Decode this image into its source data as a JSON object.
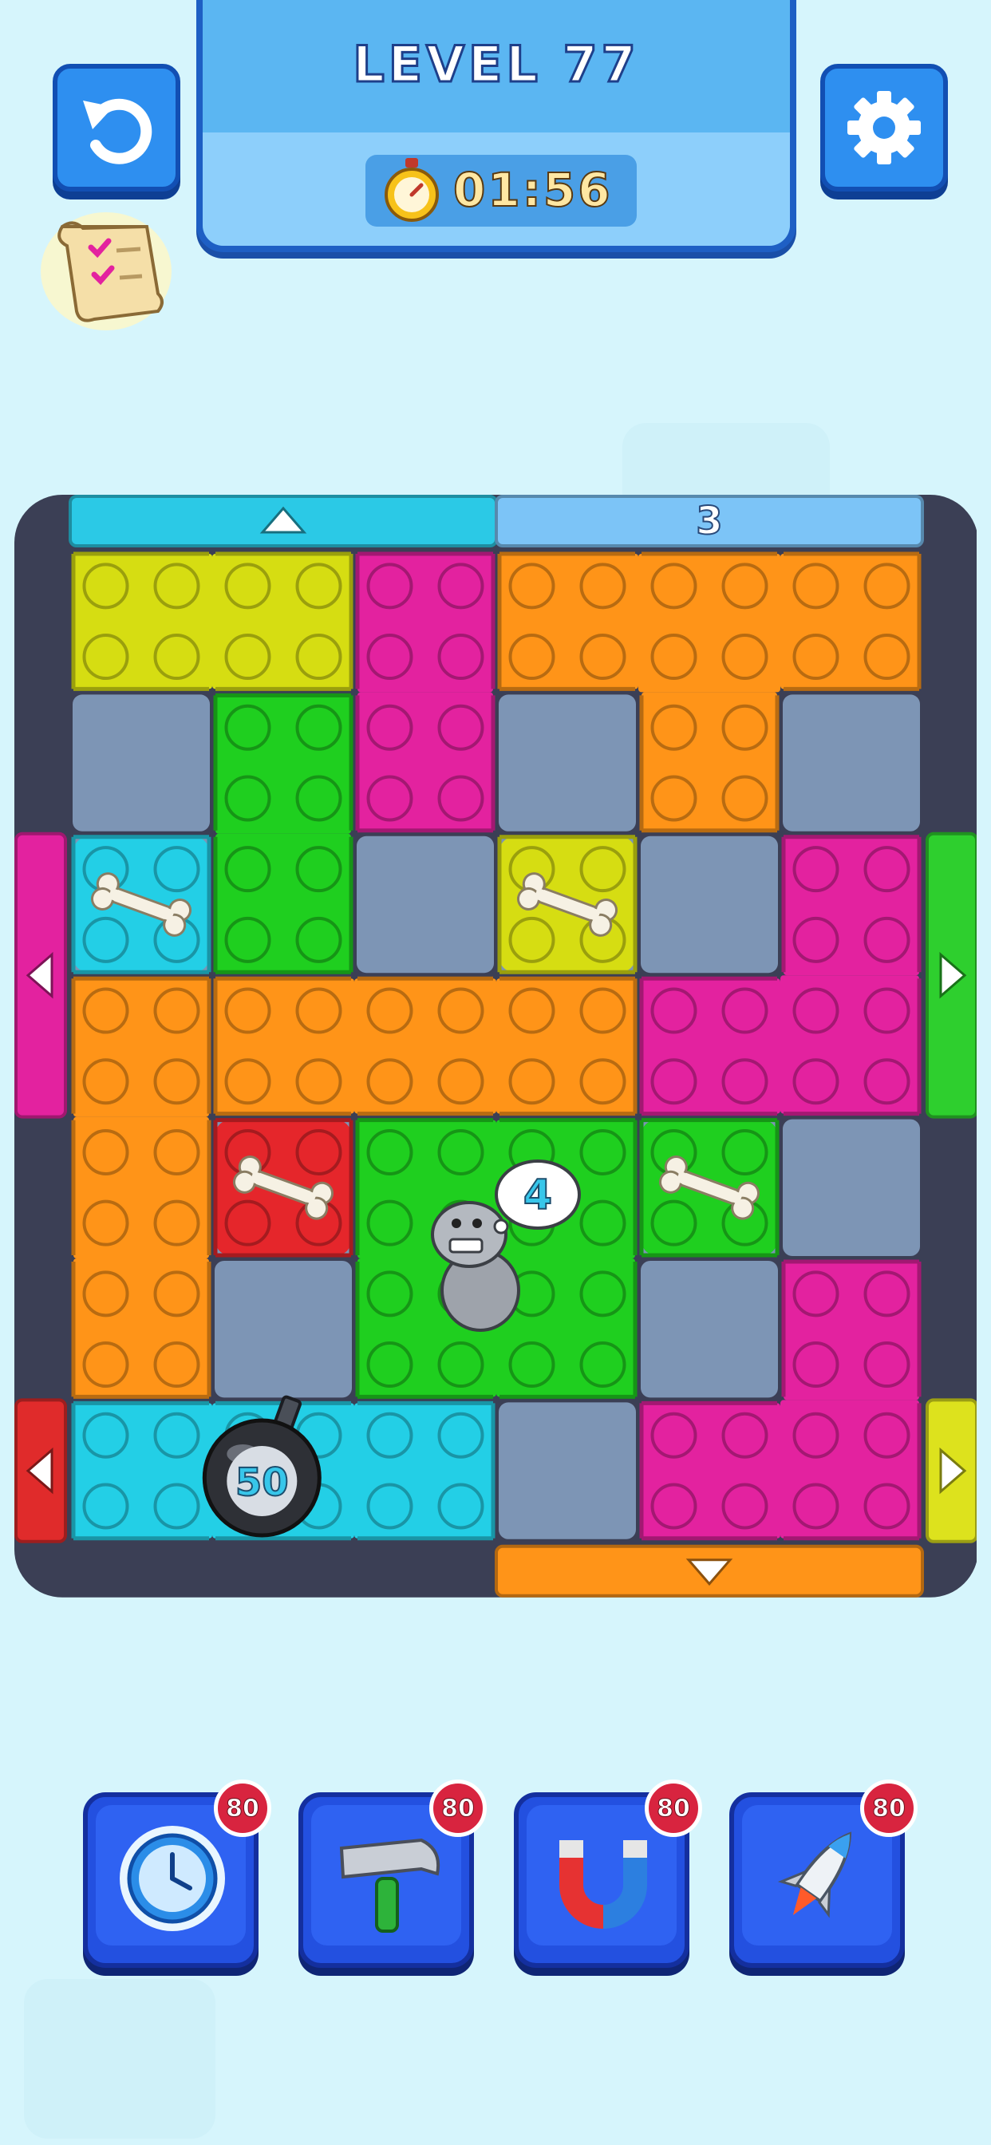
{
  "header": {
    "level_label": "LEVEL 77",
    "timer": "01:56"
  },
  "icons": {
    "undo": "undo-arrow-icon",
    "settings": "gear-icon",
    "quest": "scroll-checklist-icon",
    "timer": "stopwatch-icon"
  },
  "board": {
    "cols": 6,
    "rows": 7,
    "wall_color": "#3b3f55",
    "empty_cell_color": "#7d95b5",
    "exits": [
      {
        "side": "top",
        "color": "#2bc9e6",
        "arrow": "up",
        "span": [
          0,
          3
        ]
      },
      {
        "side": "top",
        "color": "#7cc4f7",
        "label": "3",
        "frozen": true,
        "span": [
          3,
          6
        ]
      },
      {
        "side": "left",
        "color": "#e3229f",
        "arrow": "left",
        "span": [
          2,
          4
        ]
      },
      {
        "side": "right",
        "color": "#2ecf2e",
        "arrow": "right",
        "span": [
          2,
          4
        ]
      },
      {
        "side": "left",
        "color": "#e02b2b",
        "arrow": "left",
        "span": [
          6,
          7
        ]
      },
      {
        "side": "right",
        "color": "#dde21d",
        "arrow": "right",
        "span": [
          6,
          7
        ]
      },
      {
        "side": "bottom",
        "color": "#ff9418",
        "arrow": "down",
        "span": [
          3,
          6
        ]
      }
    ],
    "blocks": [
      {
        "id": "yellow-top",
        "color": "#d6dd12",
        "cells": [
          [
            0,
            0
          ],
          [
            1,
            0
          ]
        ],
        "studs": [
          4,
          2
        ]
      },
      {
        "id": "magenta-top",
        "color": "#e3229f",
        "cells": [
          [
            2,
            0
          ],
          [
            2,
            1
          ]
        ],
        "studs": [
          2,
          4
        ]
      },
      {
        "id": "orange-t",
        "color": "#ff9418",
        "cells": [
          [
            3,
            0
          ],
          [
            4,
            0
          ],
          [
            5,
            0
          ],
          [
            4,
            1
          ]
        ],
        "studs": [
          6,
          2
        ],
        "shape": "T"
      },
      {
        "id": "green-vertical",
        "color": "#1fcf1f",
        "cells": [
          [
            1,
            1
          ],
          [
            1,
            2
          ]
        ],
        "studs": [
          2,
          4
        ]
      },
      {
        "id": "cyan-bone",
        "color": "#23cfe6",
        "cells": [
          [
            0,
            2
          ]
        ],
        "bone": true
      },
      {
        "id": "yellow-bone",
        "color": "#d6dd12",
        "cells": [
          [
            3,
            2
          ]
        ],
        "bone": true
      },
      {
        "id": "magenta-l",
        "color": "#e3229f",
        "cells": [
          [
            5,
            2
          ],
          [
            4,
            3
          ],
          [
            5,
            3
          ]
        ],
        "shape": "L"
      },
      {
        "id": "orange-vertical",
        "color": "#ff9418",
        "cells": [
          [
            0,
            3
          ],
          [
            0,
            4
          ],
          [
            0,
            5
          ]
        ],
        "studs": [
          2,
          6
        ]
      },
      {
        "id": "orange-horizontal",
        "color": "#ff9418",
        "cells": [
          [
            1,
            3
          ],
          [
            2,
            3
          ],
          [
            3,
            3
          ]
        ],
        "studs": [
          6,
          2
        ]
      },
      {
        "id": "red-bone",
        "color": "#e5262b",
        "cells": [
          [
            1,
            4
          ]
        ],
        "bone": true
      },
      {
        "id": "green-dog",
        "color": "#1fcf1f",
        "cells": [
          [
            2,
            4
          ],
          [
            3,
            4
          ],
          [
            2,
            5
          ],
          [
            3,
            5
          ]
        ],
        "dog_count": "4"
      },
      {
        "id": "green-bone",
        "color": "#1fcf1f",
        "cells": [
          [
            4,
            4
          ]
        ],
        "bone": true
      },
      {
        "id": "magenta-l2",
        "color": "#e3229f",
        "cells": [
          [
            5,
            5
          ],
          [
            4,
            6
          ],
          [
            5,
            6
          ]
        ],
        "shape": "L"
      },
      {
        "id": "cyan-bomb",
        "color": "#23cfe6",
        "cells": [
          [
            0,
            6
          ],
          [
            1,
            6
          ],
          [
            2,
            6
          ]
        ],
        "bomb": "50"
      }
    ]
  },
  "boosters": [
    {
      "name": "time-freeze",
      "icon": "clock-icon",
      "count": "80"
    },
    {
      "name": "hammer",
      "icon": "hammer-icon",
      "count": "80"
    },
    {
      "name": "magnet",
      "icon": "magnet-icon",
      "count": "80"
    },
    {
      "name": "rocket",
      "icon": "rocket-icon",
      "count": "80"
    }
  ]
}
